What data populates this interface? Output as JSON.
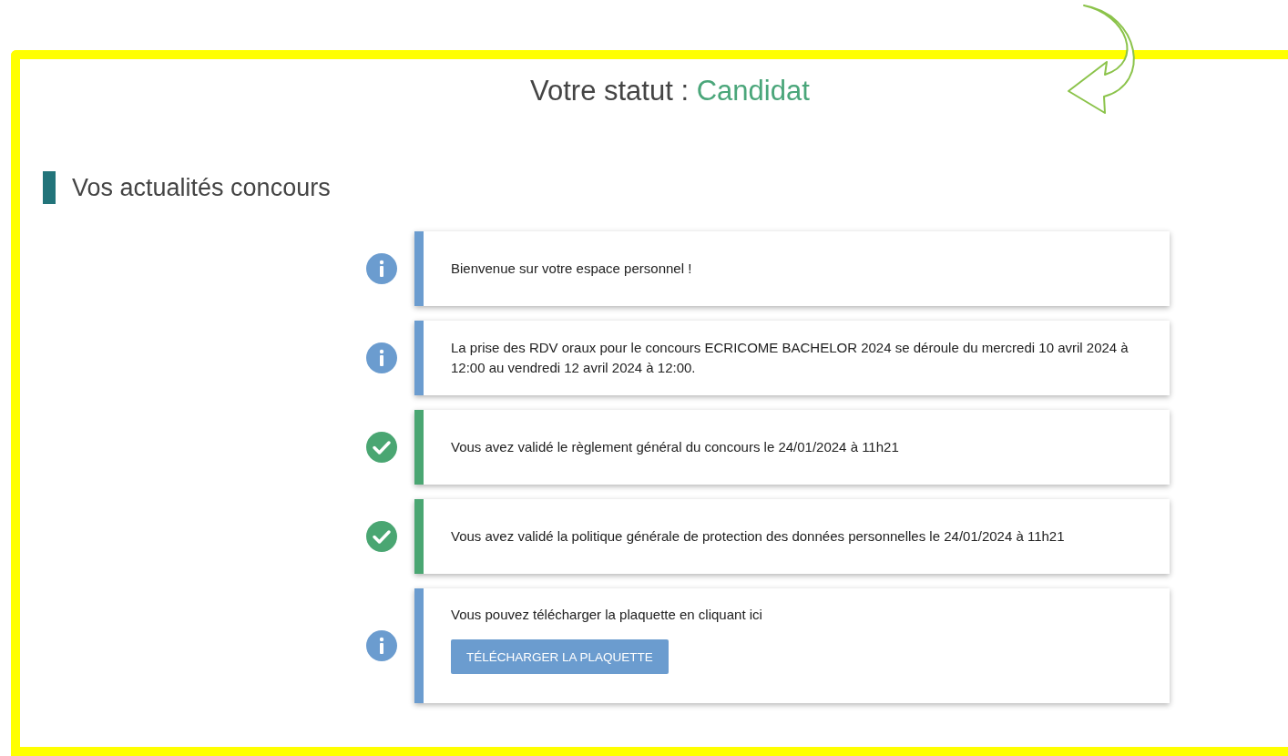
{
  "status": {
    "label": "Votre statut :",
    "value": "Candidat"
  },
  "section": {
    "title": "Vos actualités concours"
  },
  "news": [
    {
      "kind": "info",
      "text": "Bienvenue sur votre espace personnel !"
    },
    {
      "kind": "info",
      "text": "La prise des RDV oraux pour le concours ECRICOME BACHELOR 2024 se déroule du mercredi 10 avril 2024 à 12:00 au vendredi 12 avril 2024 à 12:00."
    },
    {
      "kind": "success",
      "text": "Vous avez validé le règlement général du concours le 24/01/2024 à 11h21"
    },
    {
      "kind": "success",
      "text": "Vous avez validé la politique générale de protection des données personnelles le 24/01/2024 à 11h21"
    },
    {
      "kind": "info",
      "text": "Vous pouvez télécharger la plaquette en cliquant ici",
      "button": "TÉLÉCHARGER LA PLAQUETTE"
    }
  ]
}
